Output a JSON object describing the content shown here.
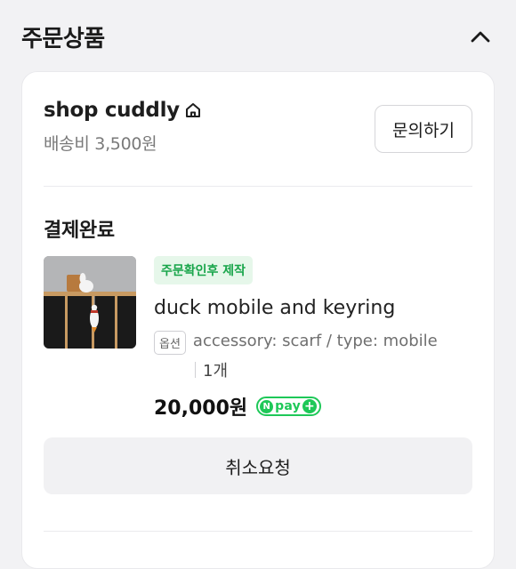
{
  "section": {
    "title": "주문상품",
    "collapse_icon": "chevron-up-icon"
  },
  "shop": {
    "name": "shop cuddly",
    "home_icon": "home-icon",
    "shipping_fee": "배송비 3,500원",
    "inquiry_label": "문의하기"
  },
  "order": {
    "status": "결제완료",
    "item": {
      "badge": "주문확인후 제작",
      "name": "duck mobile and keyring",
      "option_tag": "옵션",
      "option_text": "accessory: scarf / type: mobile",
      "quantity": "1개",
      "price": "20,000원",
      "npay": {
        "n": "N",
        "text": "pay",
        "plus": "+"
      }
    },
    "cancel_label": "취소요청"
  },
  "colors": {
    "accent_green": "#1ec858",
    "badge_bg": "#e6f7ea",
    "badge_text": "#18a54a",
    "page_bg": "#f2f2f4"
  }
}
